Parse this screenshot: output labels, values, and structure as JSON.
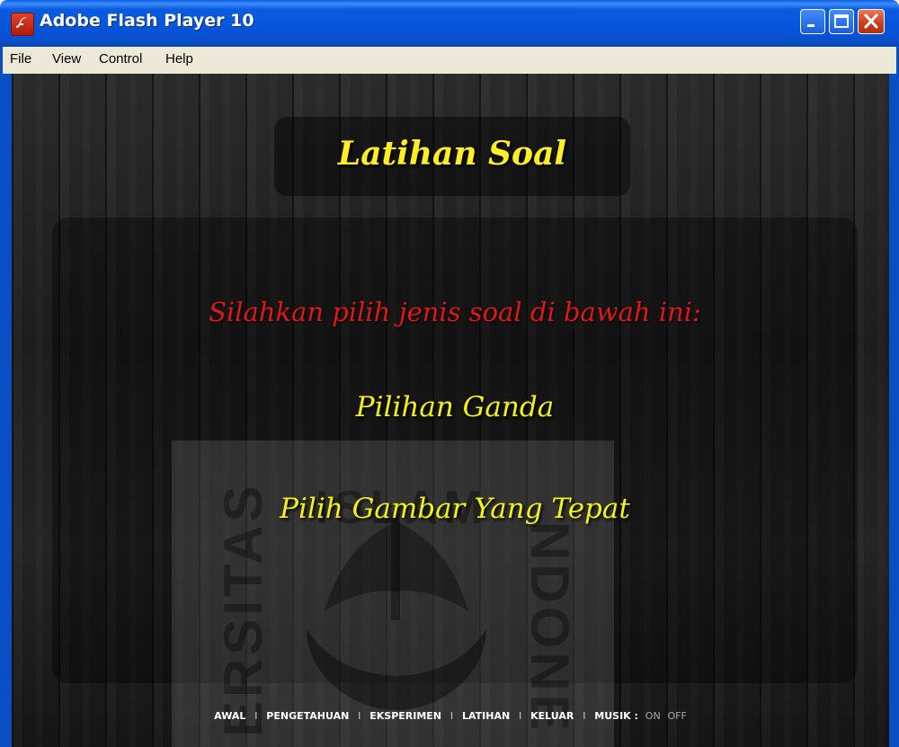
{
  "window": {
    "title": "Adobe Flash Player 10"
  },
  "menu": [
    "File",
    "View",
    "Control",
    "Help"
  ],
  "content": {
    "title": "Latihan Soal",
    "prompt": "Silahkan pilih jenis soal di bawah ini:",
    "choices": [
      "Pilihan Ganda",
      "Pilih Gambar Yang Tepat"
    ]
  },
  "footer": {
    "nav": [
      "AWAL",
      "PENGETAHUAN",
      "EKSPERIMEN",
      "LATIHAN",
      "KELUAR"
    ],
    "separator": "I",
    "music_label": "MUSIK :",
    "music_on": "ON",
    "music_off": "OFF"
  },
  "watermark_text": [
    "ISLAM",
    "ERSITAS",
    "NDONE"
  ],
  "colors": {
    "title": "#ffee22",
    "prompt": "#e01818",
    "choice": "#f2f214",
    "titlebar": "#0753d8"
  }
}
